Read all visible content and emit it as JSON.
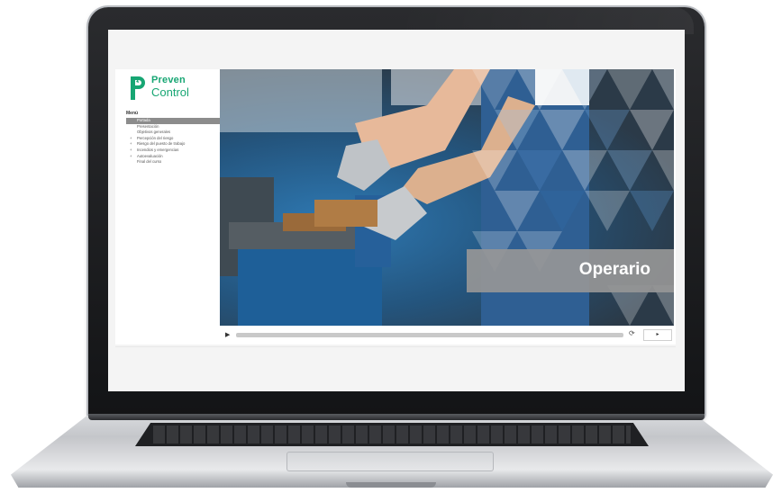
{
  "brand": {
    "name_line1": "Preven",
    "name_line2": "Control",
    "color": "#17a673"
  },
  "menu": {
    "title": "Menú",
    "items": [
      {
        "label": "Portada",
        "active": true,
        "expandable": false
      },
      {
        "label": "Presentación",
        "active": false,
        "expandable": false
      },
      {
        "label": "Objetivos generales",
        "active": false,
        "expandable": false
      },
      {
        "label": "Percepción del riesgo",
        "active": false,
        "expandable": true
      },
      {
        "label": "Riesgo del puesto de trabajo",
        "active": false,
        "expandable": true
      },
      {
        "label": "Incendios y emergencias",
        "active": false,
        "expandable": true
      },
      {
        "label": "Autoevaluación",
        "active": false,
        "expandable": true
      },
      {
        "label": "Final del curso",
        "active": false,
        "expandable": false
      }
    ]
  },
  "hero": {
    "caption": "Operario",
    "caption_bg": "#969696"
  },
  "player": {
    "play_icon": "play-icon",
    "replay_icon": "replay-icon",
    "next_icon": "chevron-right-icon",
    "progress": 0
  }
}
